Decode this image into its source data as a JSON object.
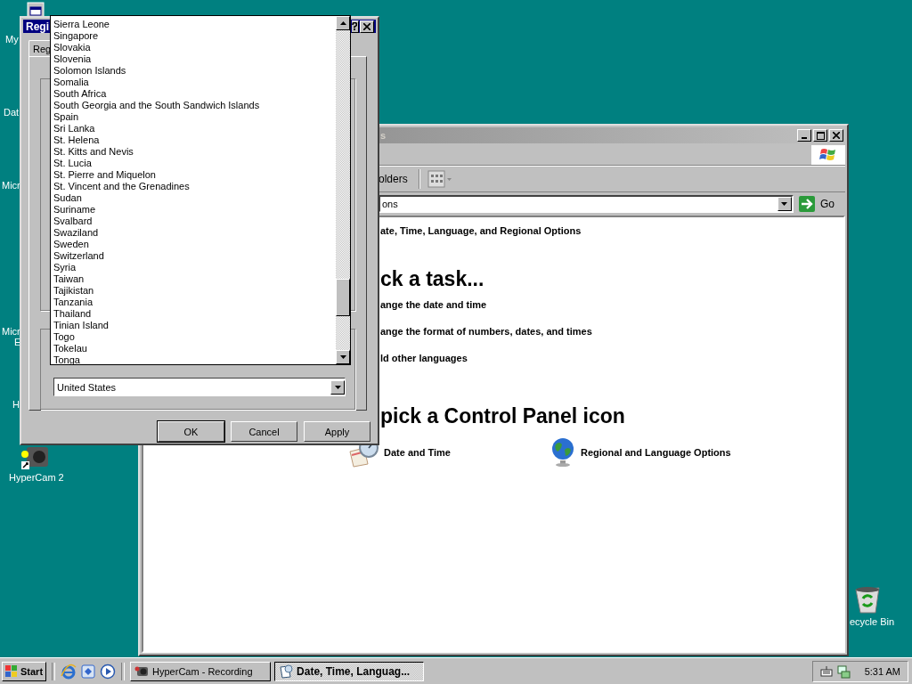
{
  "desktop_icons": [
    {
      "label": "My",
      "kind": "cut"
    },
    {
      "label": "Dat",
      "kind": "cut"
    },
    {
      "label": "Micr",
      "kind": "cut"
    },
    {
      "label": "Micr",
      "kind": "cut"
    },
    {
      "label": "E",
      "kind": "cut"
    },
    {
      "label": "H",
      "kind": "cut"
    },
    {
      "label": "HyperCam 2",
      "kind": "camera"
    },
    {
      "label": "ecycle Bin",
      "kind": "recycle"
    }
  ],
  "explorer": {
    "title": "s",
    "toolbar_button": "olders",
    "address": "ons",
    "go_button": "Go",
    "heading": "ate, Time, Language, and Regional Options",
    "task_title": "ck a task...",
    "tasks": [
      "ange the date and time",
      "ange the format of numbers, dates, and times",
      "ld other languages"
    ],
    "icon_title": "pick a Control Panel icon",
    "icons": [
      {
        "label": "Date and Time",
        "kind": "clock"
      },
      {
        "label": "Regional and Language Options",
        "kind": "globe"
      }
    ]
  },
  "dialog": {
    "title": "Regi",
    "tab": "Reg",
    "country": "United States",
    "buttons": [
      {
        "label": "OK",
        "default": true
      },
      {
        "label": "Cancel",
        "default": false
      },
      {
        "label": "Apply",
        "default": false
      }
    ]
  },
  "country_list": {
    "items": [
      "Sierra Leone",
      "Singapore",
      "Slovakia",
      "Slovenia",
      "Solomon Islands",
      "Somalia",
      "South Africa",
      "South Georgia and the South Sandwich Islands",
      "Spain",
      "Sri Lanka",
      "St. Helena",
      "St. Kitts and Nevis",
      "St. Lucia",
      "St. Pierre and Miquelon",
      "St. Vincent and the Grenadines",
      "Sudan",
      "Suriname",
      "Svalbard",
      "Swaziland",
      "Sweden",
      "Switzerland",
      "Syria",
      "Taiwan",
      "Tajikistan",
      "Tanzania",
      "Thailand",
      "Tinian Island",
      "Togo",
      "Tokelau",
      "Tonga"
    ]
  },
  "taskbar": {
    "start": "Start",
    "tasks": [
      {
        "label": "HyperCam - Recording",
        "selected": false
      },
      {
        "label": "Date, Time, Languag...",
        "selected": true
      }
    ],
    "clock": "5:31 AM"
  }
}
